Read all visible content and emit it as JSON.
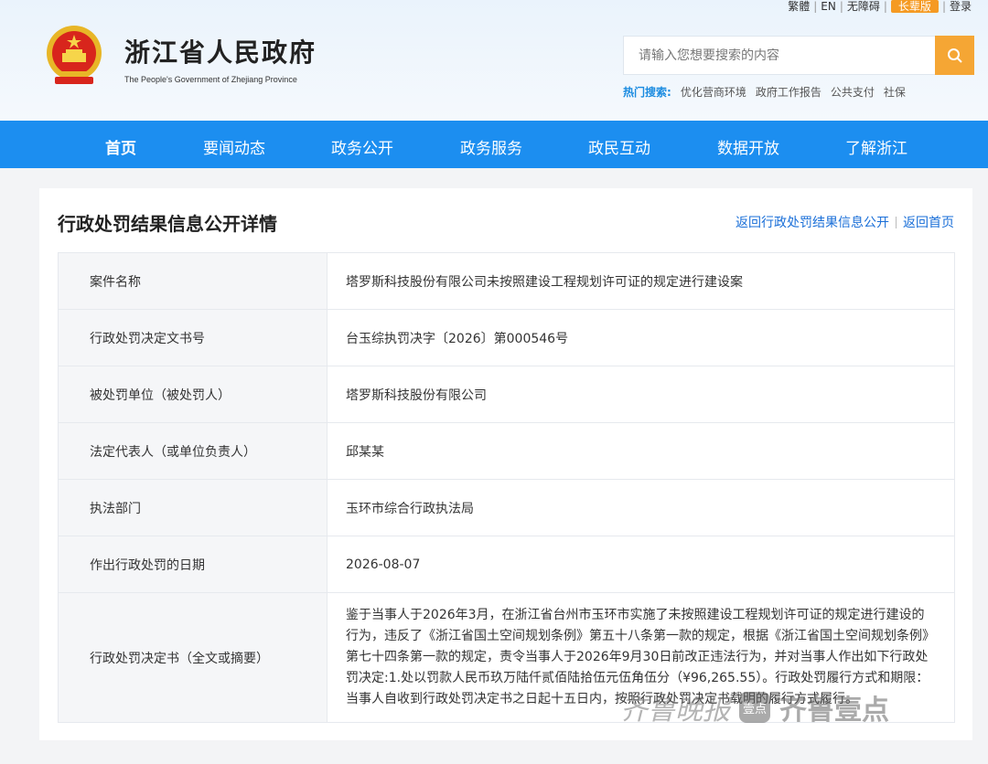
{
  "util": {
    "traditional": "繁體",
    "english": "EN",
    "accessible": "无障碍",
    "elder": "长辈版",
    "login": "登录"
  },
  "header": {
    "title": "浙江省人民政府",
    "subtitle": "The People's Government of Zhejiang Province",
    "search_placeholder": "请输入您想要搜索的内容",
    "hot_label": "热门搜索:",
    "hot_items": [
      "优化营商环境",
      "政府工作报告",
      "公共支付",
      "社保"
    ]
  },
  "nav": [
    "首页",
    "要闻动态",
    "政务公开",
    "政务服务",
    "政民互动",
    "数据开放",
    "了解浙江"
  ],
  "main": {
    "title": "行政处罚结果信息公开详情",
    "back_list": "返回行政处罚结果信息公开",
    "back_home": "返回首页",
    "rows": [
      {
        "label": "案件名称",
        "value": "塔罗斯科技股份有限公司未按照建设工程规划许可证的规定进行建设案"
      },
      {
        "label": "行政处罚决定文书号",
        "value": "台玉综执罚决字〔2026〕第000546号"
      },
      {
        "label": "被处罚单位（被处罚人）",
        "value": "塔罗斯科技股份有限公司"
      },
      {
        "label": "法定代表人（或单位负责人）",
        "value": "邱某某"
      },
      {
        "label": "执法部门",
        "value": "玉环市综合行政执法局"
      },
      {
        "label": "作出行政处罚的日期",
        "value": "2026-08-07"
      },
      {
        "label": "行政处罚决定书（全文或摘要）",
        "value": "鉴于当事人于2026年3月，在浙江省台州市玉环市实施了未按照建设工程规划许可证的规定进行建设的行为，违反了《浙江省国土空间规划条例》第五十八条第一款的规定，根据《浙江省国土空间规划条例》第七十四条第一款的规定，责令当事人于2026年9月30日前改正违法行为，并对当事人作出如下行政处罚决定:1.处以罚款人民币玖万陆仟贰佰陆拾伍元伍角伍分（¥96,265.55）。行政处罚履行方式和期限：当事人自收到行政处罚决定书之日起十五日内，按照行政处罚决定书载明的履行方式履行。"
      }
    ]
  },
  "watermark": {
    "left": "齐鲁晚报",
    "badge": "壹点",
    "right": "齐鲁壹点"
  }
}
